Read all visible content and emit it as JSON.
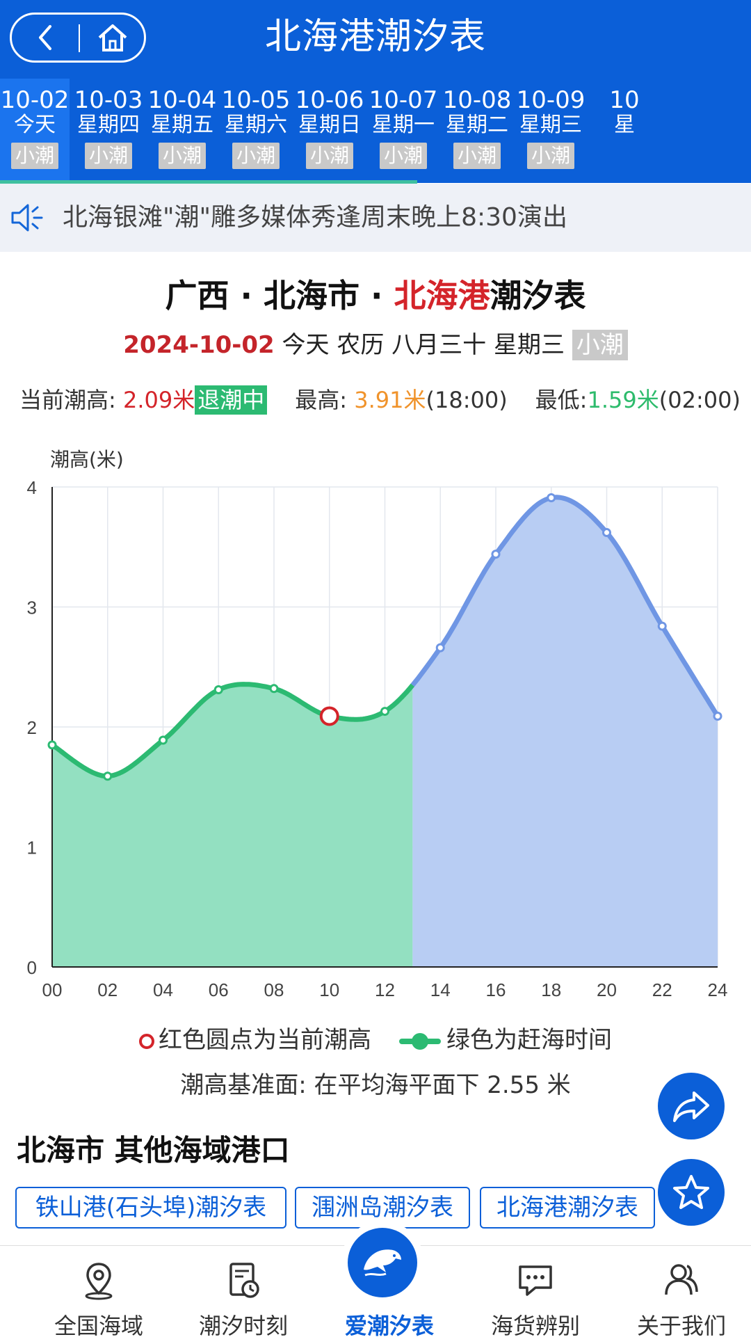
{
  "header": {
    "title": "北海港潮汐表"
  },
  "date_tabs": [
    {
      "date": "10-02",
      "weekday": "今天",
      "tide": "小潮",
      "active": true
    },
    {
      "date": "10-03",
      "weekday": "星期四",
      "tide": "小潮"
    },
    {
      "date": "10-04",
      "weekday": "星期五",
      "tide": "小潮"
    },
    {
      "date": "10-05",
      "weekday": "星期六",
      "tide": "小潮"
    },
    {
      "date": "10-06",
      "weekday": "星期日",
      "tide": "小潮"
    },
    {
      "date": "10-07",
      "weekday": "星期一",
      "tide": "小潮"
    },
    {
      "date": "10-08",
      "weekday": "星期二",
      "tide": "小潮"
    },
    {
      "date": "10-09",
      "weekday": "星期三",
      "tide": "小潮"
    },
    {
      "date": "10",
      "weekday": "星",
      "tide": ""
    }
  ],
  "notice": {
    "text": "北海银滩\"潮\"雕多媒体秀逢周末晚上8:30演出"
  },
  "main": {
    "title_prefix": "广西 · 北海市 · ",
    "title_port": "北海港",
    "title_suffix": "潮汐表",
    "sub_date": "2024-10-02",
    "sub_rest": " 今天 农历 八月三十 星期三 ",
    "sub_tag": "小潮",
    "current_label": "当前潮高: ",
    "current_value": "2.09米",
    "current_status": "退潮中",
    "max_label": "最高: ",
    "max_value": "3.91米",
    "max_time": "(18:00)",
    "min_label": "最低:",
    "min_value": "1.59米",
    "min_time": "(02:00)"
  },
  "chart_data": {
    "type": "area",
    "ylabel": "潮高(米)",
    "ylim": [
      0,
      4
    ],
    "yticks": [
      "0",
      "1",
      "2",
      "3",
      "4"
    ],
    "x": [
      "00",
      "02",
      "04",
      "06",
      "08",
      "10",
      "12",
      "14",
      "16",
      "18",
      "20",
      "22",
      "24"
    ],
    "values": [
      1.85,
      1.59,
      1.89,
      2.31,
      2.32,
      2.09,
      2.13,
      2.66,
      3.44,
      3.91,
      3.62,
      2.84,
      2.09
    ],
    "current_point": {
      "x": "10",
      "y": 2.09
    },
    "green_until_hour": 13,
    "colors": {
      "green": "#2cba72",
      "green_fill": "#93e0c1",
      "blue": "#6f96e4",
      "blue_fill": "#b8cdf3",
      "current": "#d4242a"
    }
  },
  "legend": {
    "current": "红色圆点为当前潮高",
    "green": "绿色为赶海时间"
  },
  "datum": "潮高基准面: 在平均海平面下 2.55 米",
  "section": {
    "title": "北海市 其他海域港口"
  },
  "ports": [
    "铁山港(石头埠)潮汐表",
    "涠洲岛潮汐表",
    "北海港潮汐表"
  ],
  "fabs": {
    "share": "share-icon",
    "favorite": "star-icon"
  },
  "tabbar": [
    {
      "label": "全国海域",
      "icon": "location-pin-icon"
    },
    {
      "label": "潮汐时刻",
      "icon": "tide-clock-icon"
    },
    {
      "label": "爱潮汐表",
      "icon": "dolphin-icon"
    },
    {
      "label": "海货辨别",
      "icon": "chat-bubble-icon"
    },
    {
      "label": "关于我们",
      "icon": "users-icon"
    }
  ]
}
